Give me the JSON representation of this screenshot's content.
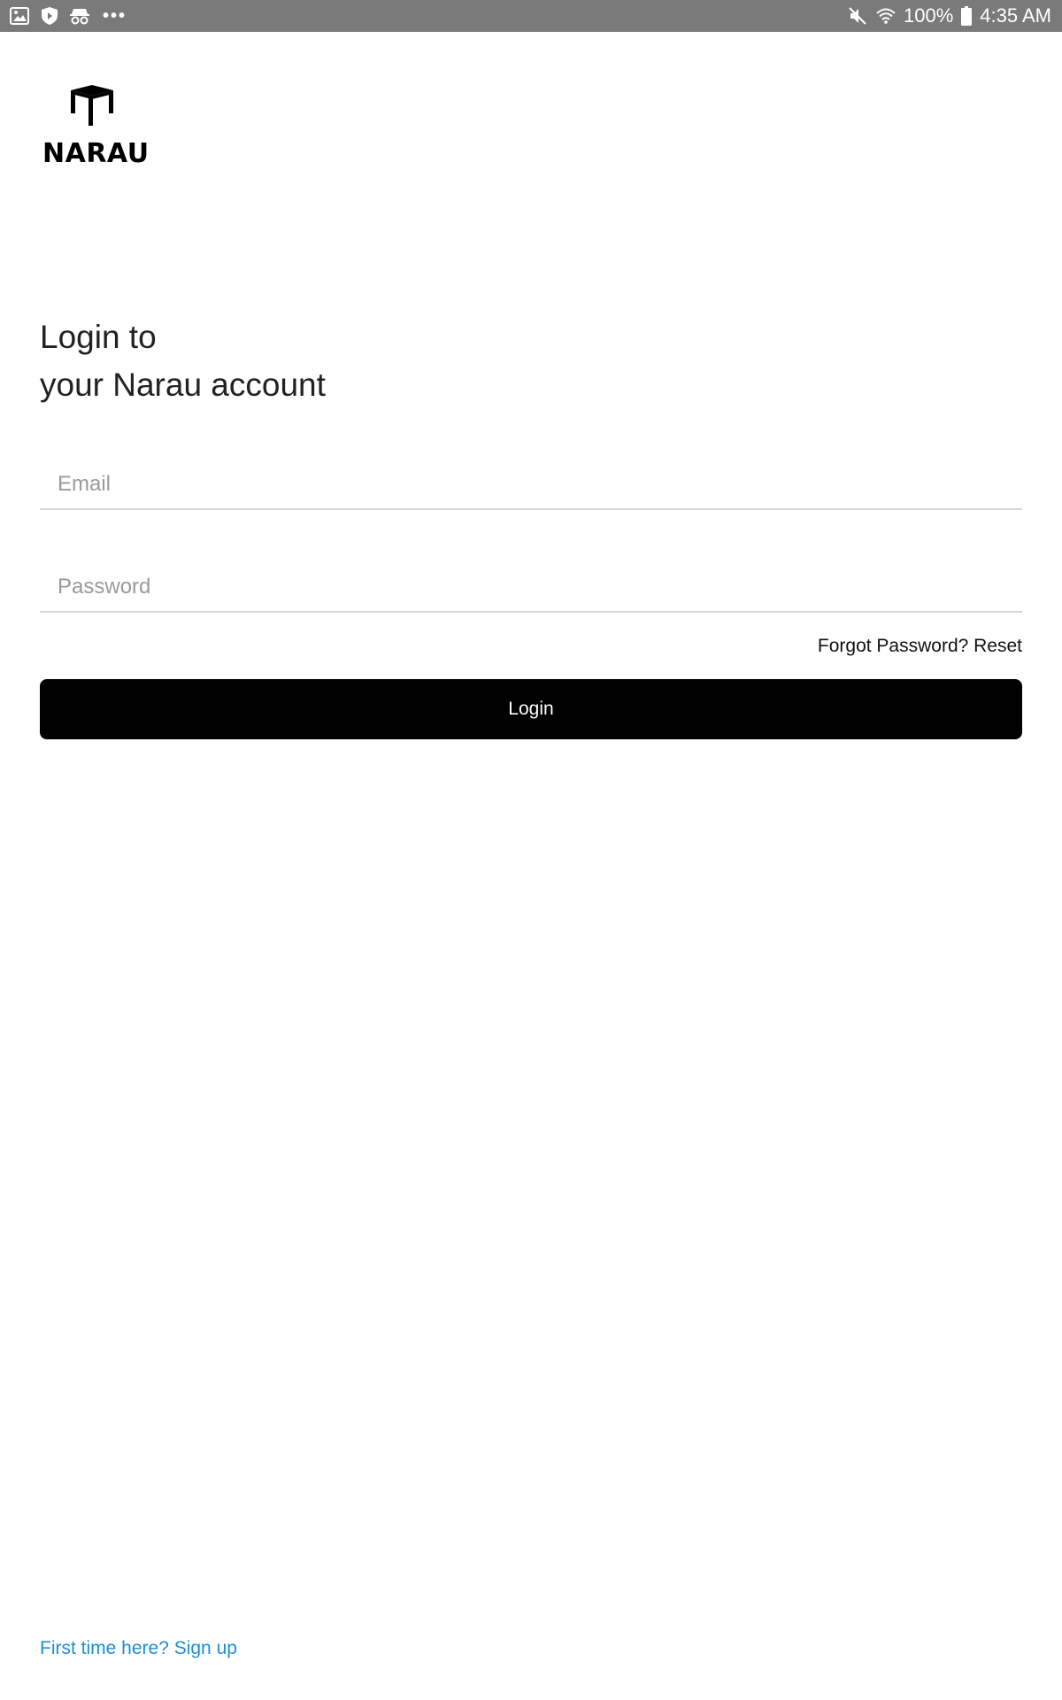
{
  "status_bar": {
    "icons_left": [
      "gallery-icon",
      "shield-icon",
      "incognito-icon",
      "more-dots-icon"
    ],
    "icons_right": [
      "mute-icon",
      "wifi-icon",
      "battery-icon"
    ],
    "battery": "100%",
    "time": "4:35 AM"
  },
  "logo": {
    "text": "NARAU",
    "icon": "table-icon"
  },
  "heading": {
    "line1": "Login to",
    "line2": "your Narau account"
  },
  "form": {
    "email_placeholder": "Email",
    "email_value": "",
    "password_placeholder": "Password",
    "password_value": "",
    "forgot_label": "Forgot Password? Reset",
    "login_label": "Login"
  },
  "footer": {
    "signup_label": "First time here? Sign up"
  },
  "colors": {
    "status_bar": "#7a7a7a",
    "button": "#000000",
    "link": "#1c8fd0"
  }
}
